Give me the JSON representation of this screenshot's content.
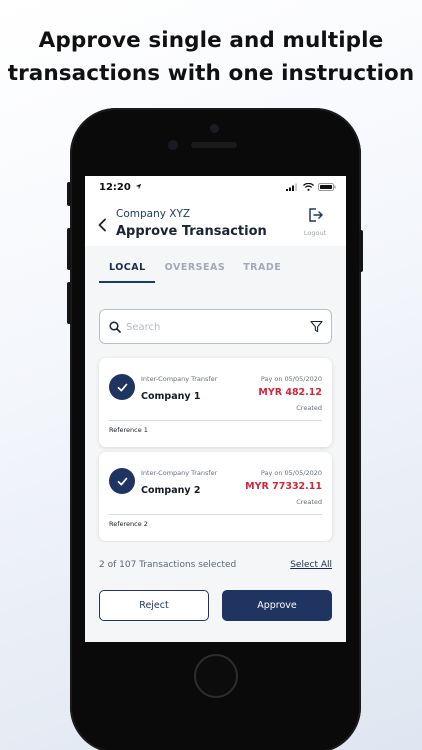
{
  "headline": {
    "line1": "Approve single and multiple",
    "line2": "transactions with one instruction"
  },
  "status_bar": {
    "time": "12:20",
    "icons": [
      "location-arrow-icon",
      "cellular-signal-icon",
      "wifi-icon",
      "battery-icon"
    ]
  },
  "header": {
    "company": "Company XYZ",
    "title": "Approve Transaction",
    "logout_label": "Logout"
  },
  "tabs": [
    {
      "label": "LOCAL",
      "active": true
    },
    {
      "label": "OVERSEAS",
      "active": false
    },
    {
      "label": "TRADE",
      "active": false
    }
  ],
  "search": {
    "placeholder": "Search",
    "value": ""
  },
  "transactions": [
    {
      "type": "Inter-Company Transfer",
      "company": "Company 1",
      "pay_on": "Pay on 05/05/2020",
      "amount": "MYR 482.12",
      "status": "Created",
      "reference": "Reference 1",
      "selected": true
    },
    {
      "type": "Inter-Company Transfer",
      "company": "Company 2",
      "pay_on": "Pay on 05/05/2020",
      "amount": "MYR 77332.11",
      "status": "Created",
      "reference": "Reference 2",
      "selected": true
    }
  ],
  "footer": {
    "selected_text": "2 of 107 Transactions selected",
    "select_all": "Select All",
    "reject_label": "Reject",
    "approve_label": "Approve"
  },
  "colors": {
    "primary": "#1f3460",
    "amount": "#d2263a",
    "muted": "#a3a9b5"
  }
}
